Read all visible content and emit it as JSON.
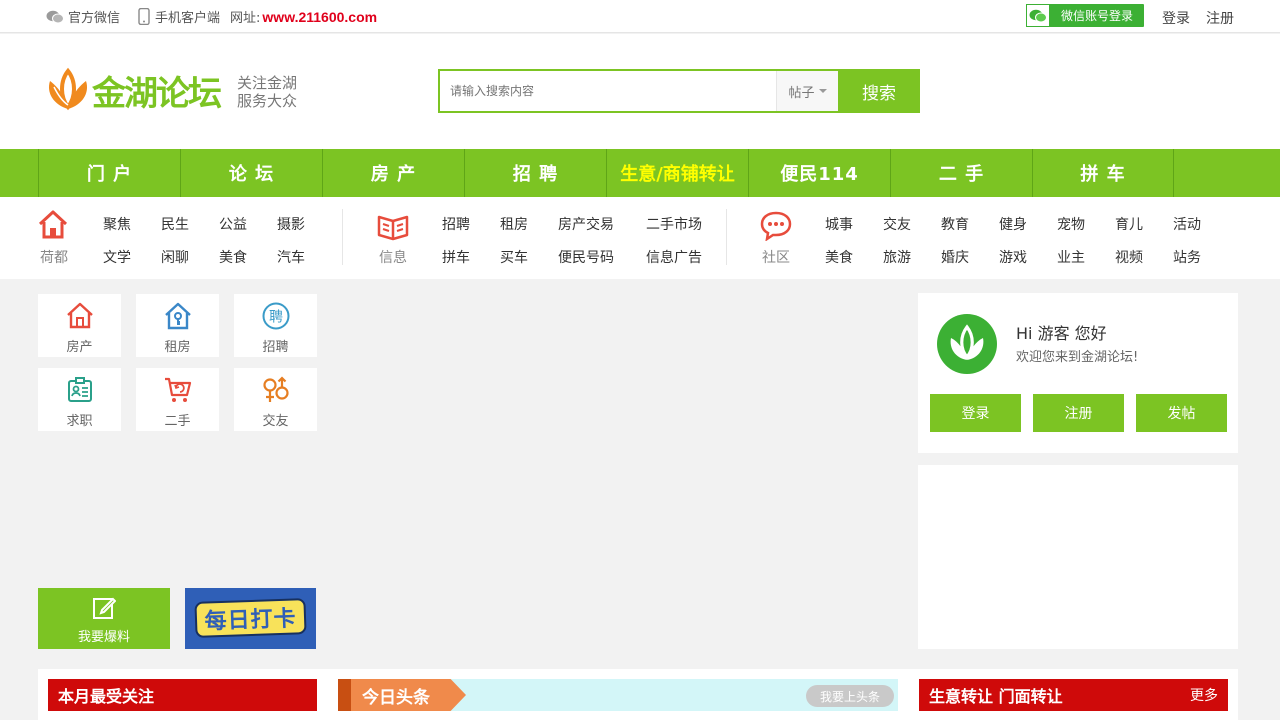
{
  "topbar": {
    "wechat_label": "官方微信",
    "mobile_label": "手机客户端",
    "url_label": "网址:",
    "url": "www.211600.com",
    "wx_login": "微信账号登录",
    "login": "登录",
    "register": "注册"
  },
  "header": {
    "slogan_line1": "关注金湖",
    "slogan_line2": "服务大众",
    "search_placeholder": "请输入搜索内容",
    "search_scope": "帖子",
    "search_button": "搜索"
  },
  "nav": {
    "items": [
      "门 户",
      "论 坛",
      "房 产",
      "招 聘",
      "生意/商铺转让",
      "便民114",
      "二 手",
      "拼 车"
    ]
  },
  "subnav": {
    "group1": {
      "label": "荷都",
      "links": [
        "聚焦",
        "民生",
        "公益",
        "摄影",
        "文学",
        "闲聊",
        "美食",
        "汽车"
      ]
    },
    "group2": {
      "label": "信息",
      "links": [
        "招聘",
        "租房",
        "房产交易",
        "二手市场",
        "拼车",
        "买车",
        "便民号码",
        "信息广告"
      ]
    },
    "group3": {
      "label": "社区",
      "links": [
        "城事",
        "交友",
        "教育",
        "健身",
        "宠物",
        "育儿",
        "活动",
        "美食",
        "旅游",
        "婚庆",
        "游戏",
        "业主",
        "视频",
        "站务"
      ]
    }
  },
  "tiles": [
    {
      "label": "房产",
      "icon": "house-icon",
      "color": "#e74c3c"
    },
    {
      "label": "租房",
      "icon": "rent-key-icon",
      "color": "#3a87c8"
    },
    {
      "label": "招聘",
      "icon": "recruit-icon",
      "color": "#3a9bc8"
    },
    {
      "label": "求职",
      "icon": "resume-icon",
      "color": "#2aa08a"
    },
    {
      "label": "二手",
      "icon": "cart-icon",
      "color": "#e74c3c"
    },
    {
      "label": "交友",
      "icon": "gender-icon",
      "color": "#e67e22"
    }
  ],
  "baoliao": "我要爆料",
  "daka": "每日打卡",
  "user": {
    "greeting": "Hi 游客 您好",
    "welcome": "欢迎您来到金湖论坛!",
    "btn_login": "登录",
    "btn_register": "注册",
    "btn_post": "发帖"
  },
  "sections": {
    "monthly": "本月最受关注",
    "today": "今日头条",
    "today_pill": "我要上头条",
    "business": "生意转让 门面转让",
    "more": "更多"
  },
  "colors": {
    "brand_green": "#7cc423",
    "nav_highlight": "#ffff00",
    "url_red": "#e0001b",
    "section_red": "#cf0a0a",
    "today_orange": "#f08a4b"
  }
}
